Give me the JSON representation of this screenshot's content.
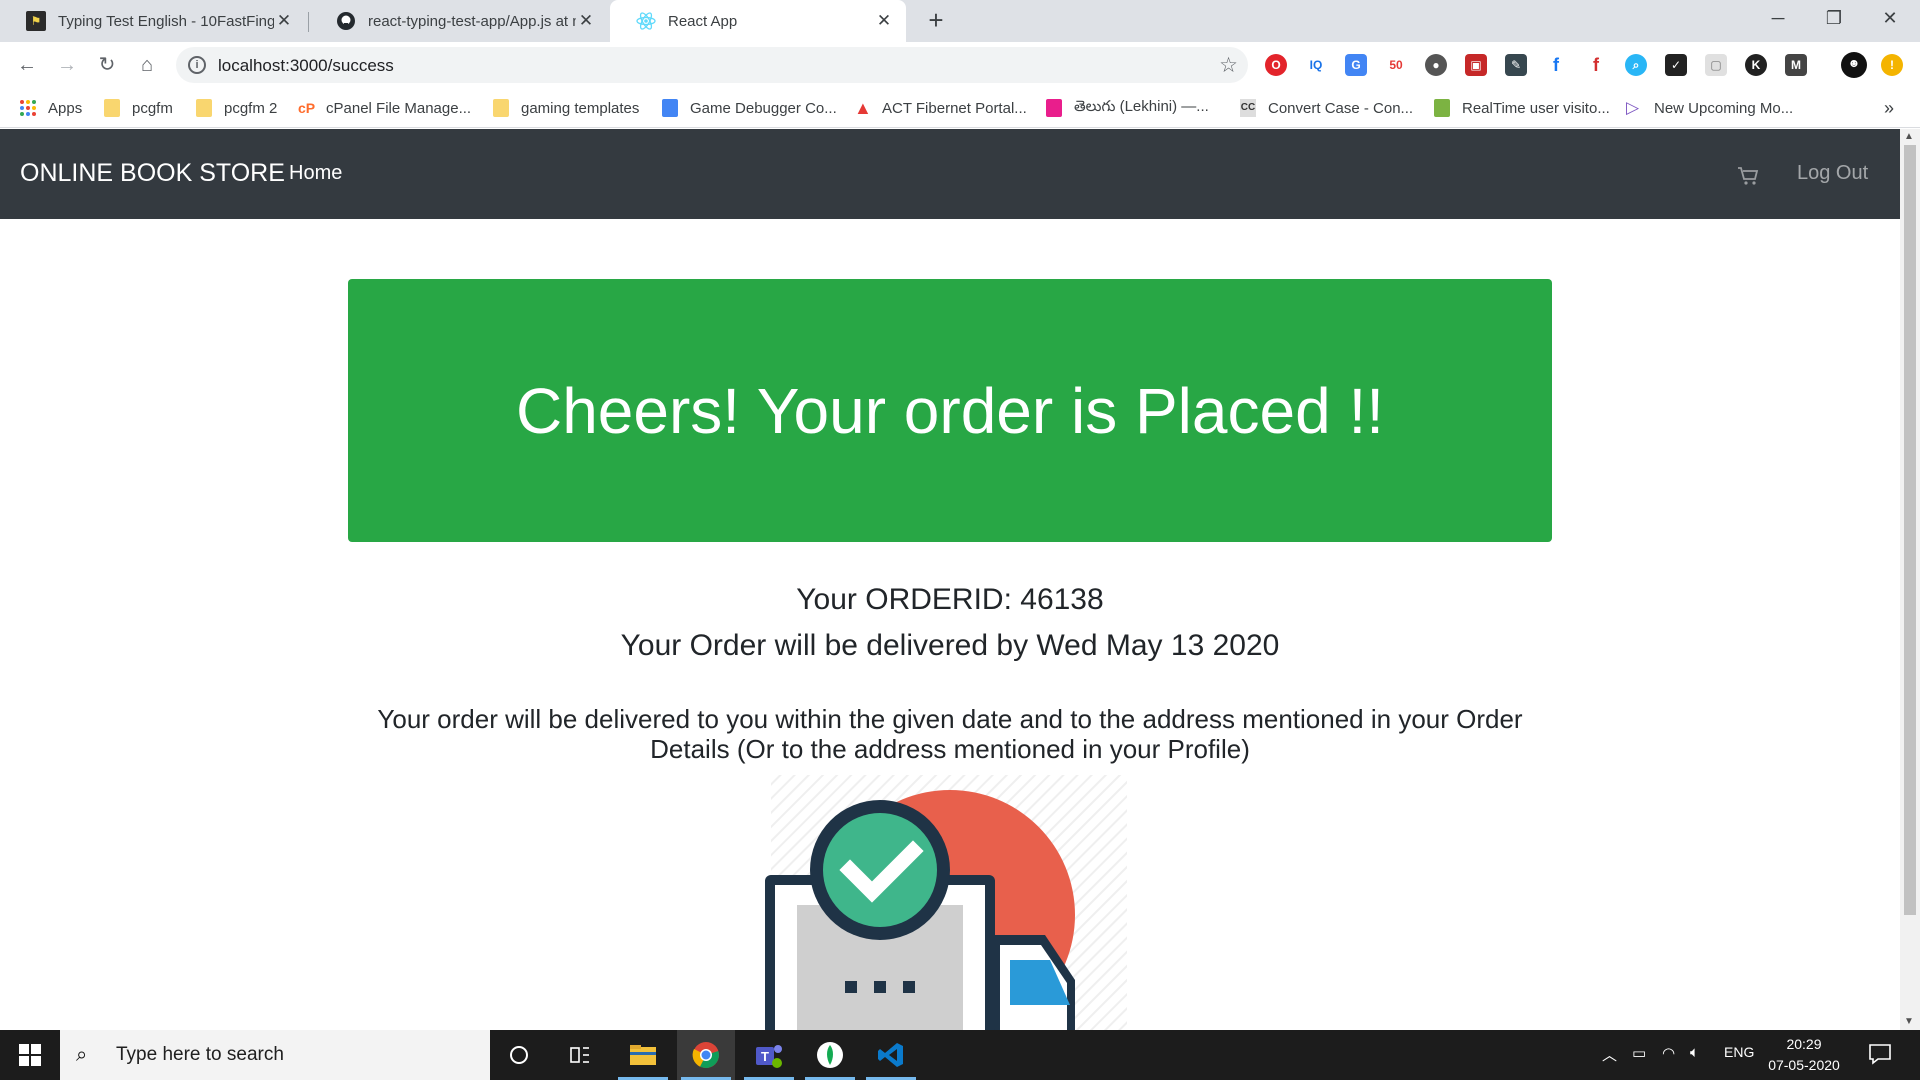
{
  "browser": {
    "tabs": [
      {
        "title": "Typing Test English - 10FastFingers",
        "icon": "tenfastfingers-icon"
      },
      {
        "title": "react-typing-test-app/App.js at master",
        "icon": "github-icon"
      },
      {
        "title": "React App",
        "icon": "react-icon",
        "active": true
      }
    ],
    "address": "localhost:3000/success",
    "bookmarks": [
      {
        "label": "Apps",
        "icon": "apps-grid-icon"
      },
      {
        "label": "pcgfm",
        "icon": "folder-icon"
      },
      {
        "label": "pcgfm 2",
        "icon": "folder-icon"
      },
      {
        "label": "cPanel File Manage...",
        "icon": "cpanel-icon"
      },
      {
        "label": "gaming templates",
        "icon": "folder-icon"
      },
      {
        "label": "Game Debugger Co...",
        "icon": "docs-icon"
      },
      {
        "label": "ACT Fibernet Portal...",
        "icon": "act-icon"
      },
      {
        "label": "తెలుగు (Lekhini) —...",
        "icon": "lekhini-icon"
      },
      {
        "label": "Convert Case - Con...",
        "icon": "cc-icon"
      },
      {
        "label": "RealTime user visito...",
        "icon": "realtime-icon"
      },
      {
        "label": "New Upcoming Mo...",
        "icon": "play-icon"
      }
    ],
    "more_bookmarks": "»"
  },
  "navbar": {
    "brand": "ONLINE BOOK STORE",
    "home": "Home",
    "logout": "Log Out"
  },
  "success": {
    "heading": "Cheers! Your order is Placed !!",
    "order_id_text": "Your ORDERID: 46138",
    "delivery_text": "Your Order will be delivered by Wed May 13 2020",
    "note": "Your order will be delivered to you within the given date and to the address mentioned in your Order Details (Or to the address mentioned in your Profile)"
  },
  "taskbar": {
    "search_placeholder": "Type here to search",
    "language": "ENG",
    "time": "20:29",
    "date": "07-05-2020"
  },
  "colors": {
    "success_green": "#28a745",
    "navbar_dark": "#343a40",
    "illus_red": "#e8604c",
    "illus_teal": "#3fb68b",
    "illus_navy": "#1f3346",
    "illus_blue": "#2a9ad8"
  }
}
